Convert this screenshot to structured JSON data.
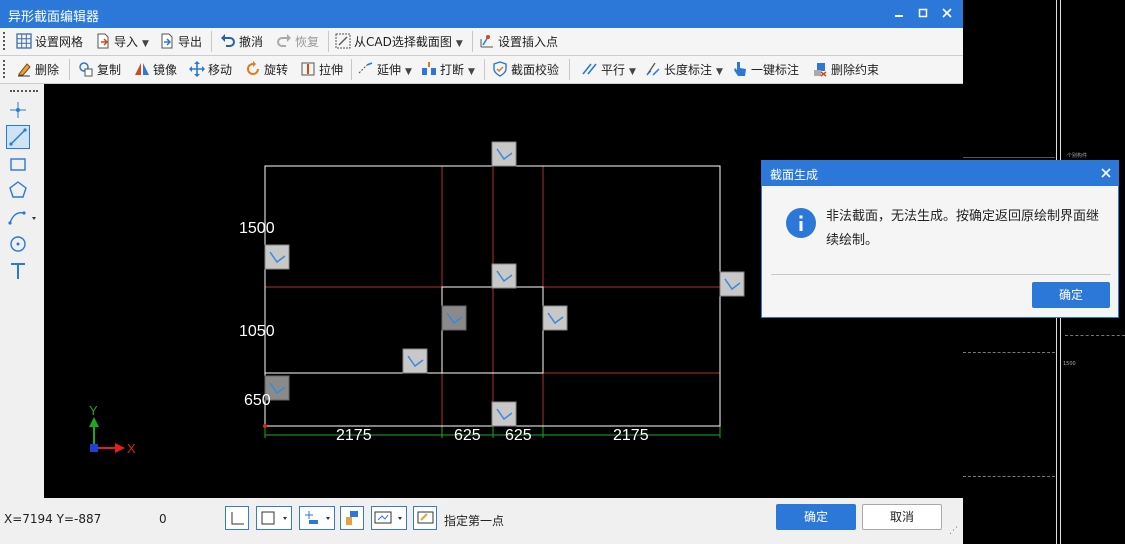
{
  "window": {
    "title": "异形截面编辑器"
  },
  "toolbar1": {
    "set_grid": "设置网格",
    "import": "导入",
    "export": "导出",
    "undo": "撤消",
    "redo": "恢复",
    "select_from_cad": "从CAD选择截面图",
    "set_insert_point": "设置插入点"
  },
  "toolbar2": {
    "delete": "删除",
    "copy": "复制",
    "mirror": "镜像",
    "move": "移动",
    "rotate": "旋转",
    "stretch": "拉伸",
    "extend": "延伸",
    "break": "打断",
    "check": "截面校验",
    "parallel": "平行",
    "length_dim": "长度标注",
    "one_key_dim": "一键标注",
    "delete_constraint": "删除约束"
  },
  "drawing": {
    "dims_left": [
      "1500",
      "1050",
      "650"
    ],
    "dims_bottom": [
      "2175",
      "625",
      "625",
      "2175"
    ],
    "axis_x": "X",
    "axis_y": "Y"
  },
  "status": {
    "coords": "X=7194 Y=-887",
    "value": "0",
    "prompt": "指定第一点",
    "ok": "确定",
    "cancel": "取消"
  },
  "dialog": {
    "title": "截面生成",
    "message": "非法截面，无法生成。按确定返回原绘制界面继续绘制。",
    "ok": "确定"
  },
  "background_text": {
    "label_a": "个别构件",
    "label_b": "1500"
  },
  "colors": {
    "accent": "#2b78d8",
    "grid_red": "#b03030",
    "dim_green": "#1fa81f"
  }
}
